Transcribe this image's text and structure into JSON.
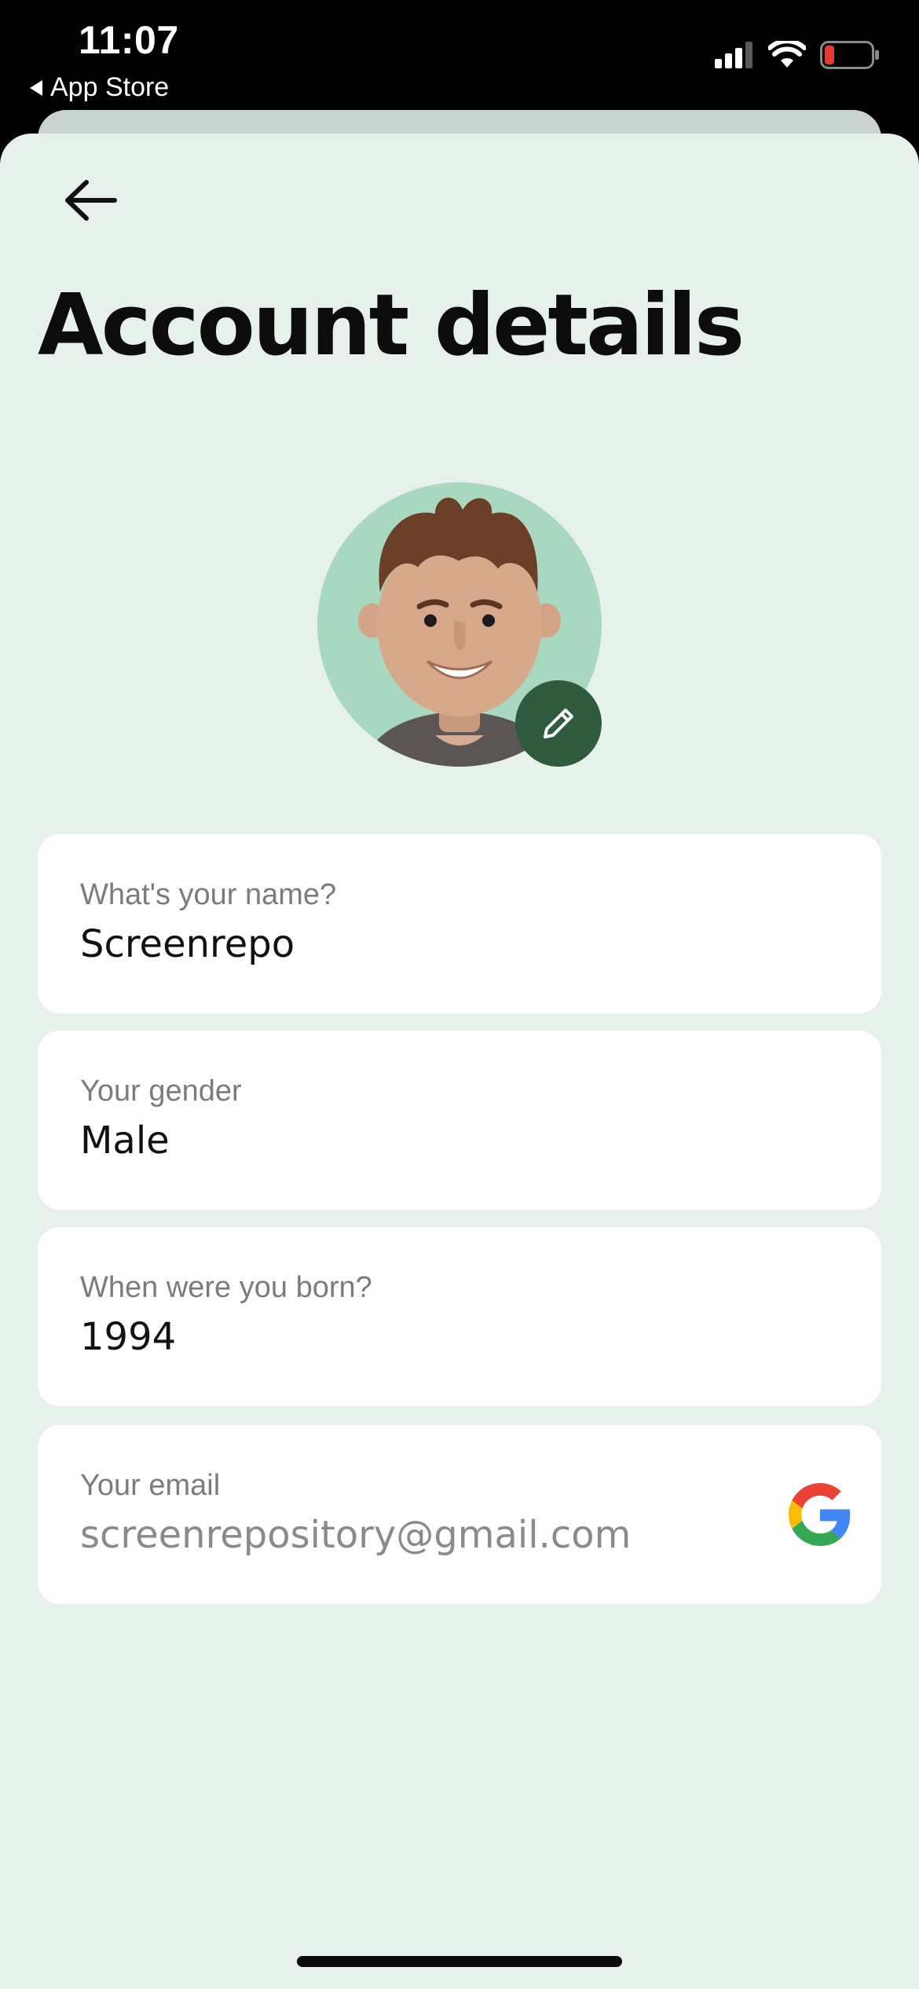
{
  "status_bar": {
    "time": "11:07",
    "back_label": "App Store",
    "icons": [
      "cellular-signal-icon",
      "wifi-icon",
      "battery-low-icon"
    ]
  },
  "header": {
    "back_icon": "arrow-left-icon",
    "title": "Account details"
  },
  "avatar": {
    "icon": "user-avatar",
    "edit_icon": "pencil-icon"
  },
  "fields": [
    {
      "label": "What's your name?",
      "value": "Screenrepo"
    },
    {
      "label": "Your gender",
      "value": "Male"
    },
    {
      "label": "When were you born?",
      "value": "1994"
    },
    {
      "label": "Your email",
      "value": "screenrepository@gmail.com",
      "provider_icon": "google-icon"
    }
  ],
  "colors": {
    "background": "#e7f1ec",
    "card": "#ffffff",
    "avatar_bg": "#a8d9c0",
    "edit_button": "#2e5a3e",
    "label": "#7c7c7c"
  }
}
